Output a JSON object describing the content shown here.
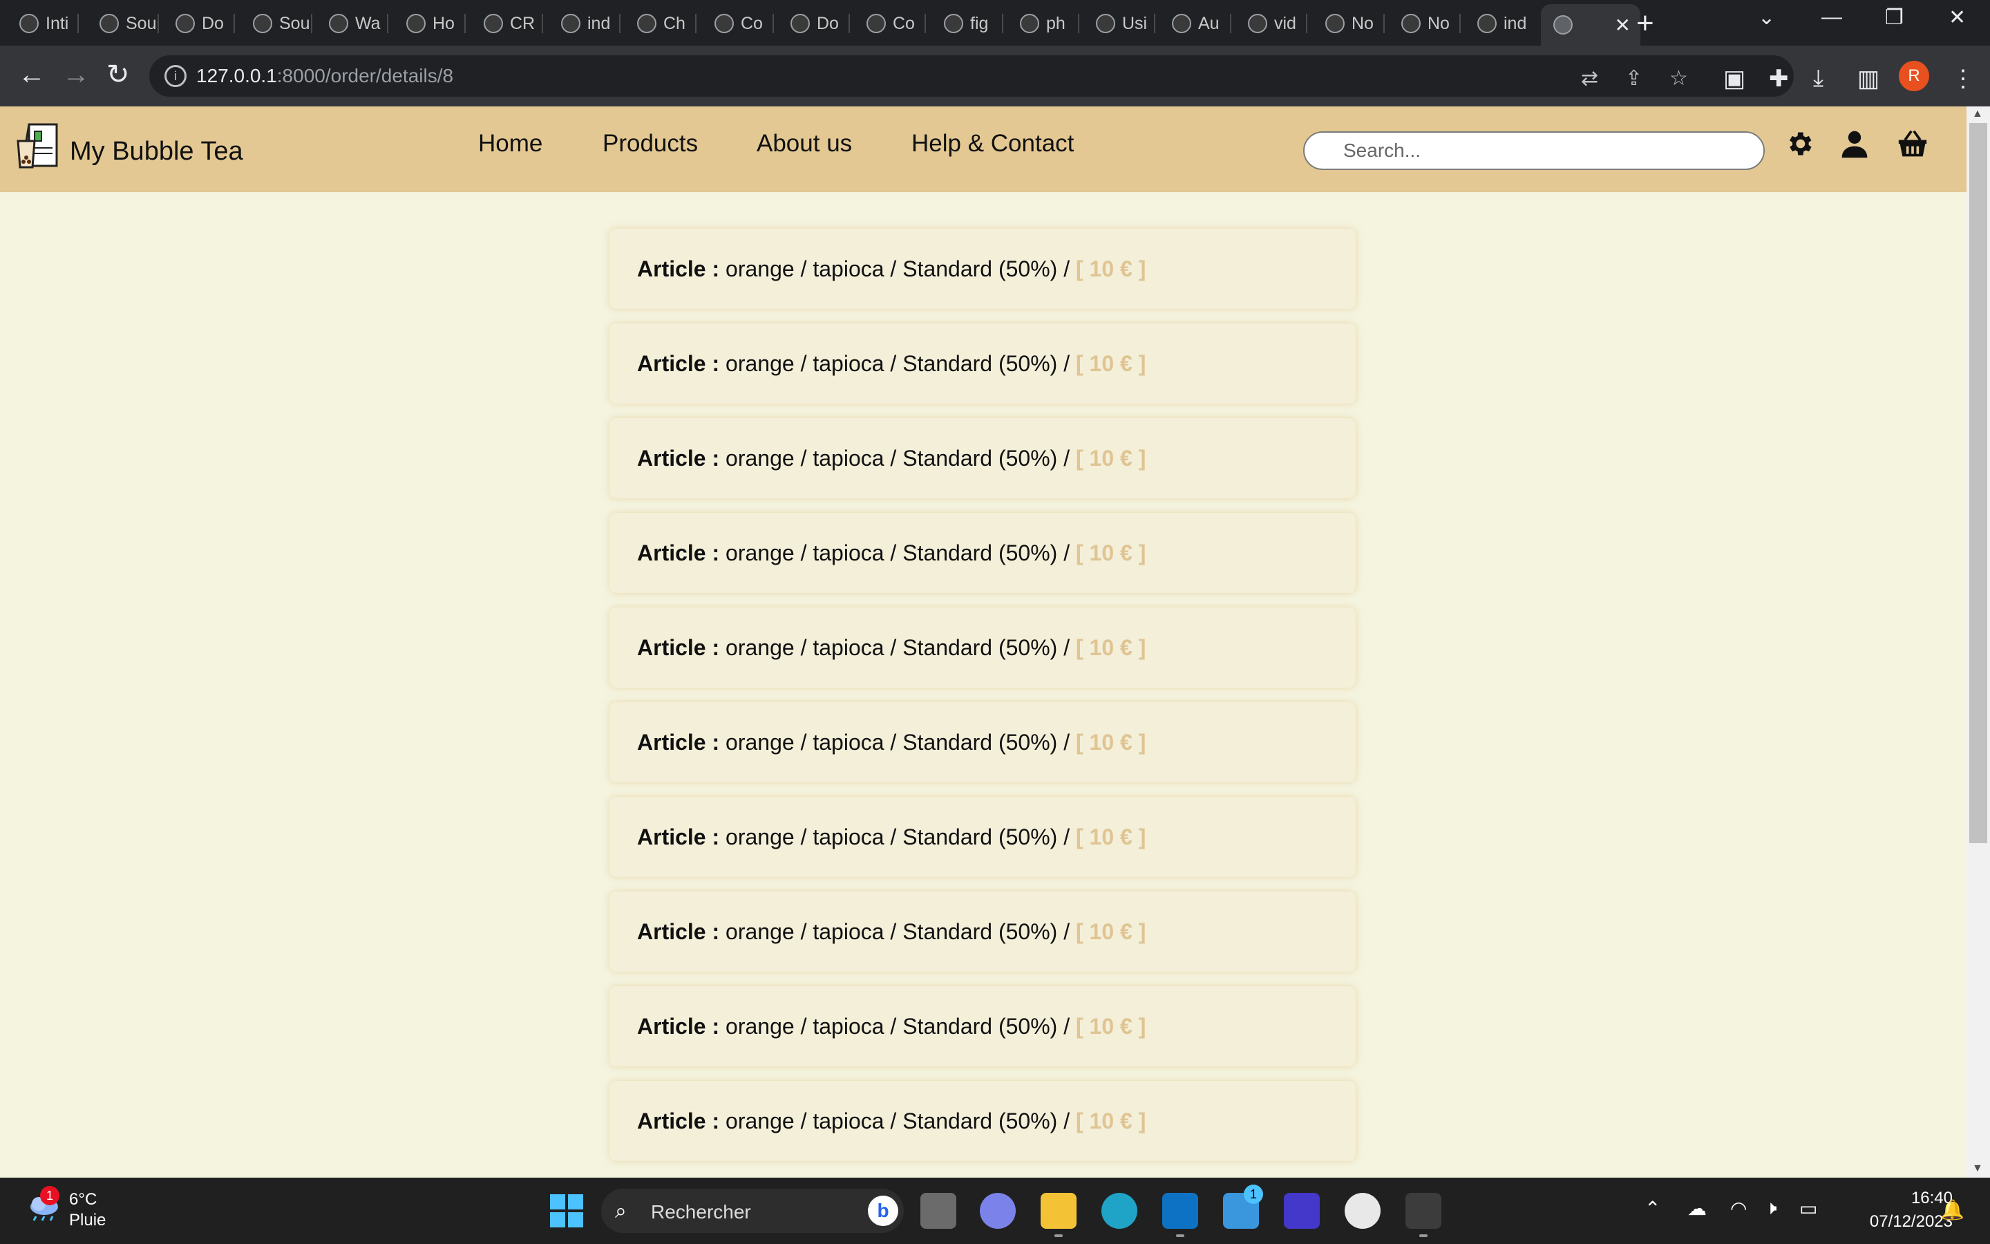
{
  "browser": {
    "tabs": [
      {
        "label": "Inti"
      },
      {
        "label": "Sou"
      },
      {
        "label": "Do"
      },
      {
        "label": "Sou"
      },
      {
        "label": "Wa"
      },
      {
        "label": "Ho"
      },
      {
        "label": "CR"
      },
      {
        "label": "ind"
      },
      {
        "label": "Ch"
      },
      {
        "label": "Co"
      },
      {
        "label": "Do"
      },
      {
        "label": "Co"
      },
      {
        "label": "fig"
      },
      {
        "label": "ph"
      },
      {
        "label": "Usi"
      },
      {
        "label": "Au"
      },
      {
        "label": "vid"
      },
      {
        "label": "No"
      },
      {
        "label": "No"
      },
      {
        "label": "ind"
      }
    ],
    "url_host": "127.0.0.1",
    "url_path": ":8000/order/details/8",
    "profile_initial": "R"
  },
  "site": {
    "brand": "My Bubble Tea",
    "nav": [
      {
        "label": "Home"
      },
      {
        "label": "Products"
      },
      {
        "label": "About us"
      },
      {
        "label": "Help & Contact"
      }
    ],
    "search_placeholder": "Search..."
  },
  "order": {
    "items": [
      {
        "label": "Article :",
        "desc": "orange / tapioca / Standard (50%) /",
        "price": "[ 10 € ]"
      },
      {
        "label": "Article :",
        "desc": "orange / tapioca / Standard (50%) /",
        "price": "[ 10 € ]"
      },
      {
        "label": "Article :",
        "desc": "orange / tapioca / Standard (50%) /",
        "price": "[ 10 € ]"
      },
      {
        "label": "Article :",
        "desc": "orange / tapioca / Standard (50%) /",
        "price": "[ 10 € ]"
      },
      {
        "label": "Article :",
        "desc": "orange / tapioca / Standard (50%) /",
        "price": "[ 10 € ]"
      },
      {
        "label": "Article :",
        "desc": "orange / tapioca / Standard (50%) /",
        "price": "[ 10 € ]"
      },
      {
        "label": "Article :",
        "desc": "orange / tapioca / Standard (50%) /",
        "price": "[ 10 € ]"
      },
      {
        "label": "Article :",
        "desc": "orange / tapioca / Standard (50%) /",
        "price": "[ 10 € ]"
      },
      {
        "label": "Article :",
        "desc": "orange / tapioca / Standard (50%) /",
        "price": "[ 10 € ]"
      },
      {
        "label": "Article :",
        "desc": "orange / tapioca / Standard (50%) /",
        "price": "[ 10 € ]"
      }
    ]
  },
  "taskbar": {
    "weather_badge": "1",
    "temperature": "6°C",
    "weather": "Pluie",
    "search_placeholder": "Rechercher",
    "store_badge": "1",
    "time": "16:40",
    "date": "07/12/2023"
  },
  "colors": {
    "header_bg": "#e3c893",
    "page_bg": "#f4f4df",
    "card_bg": "#f3efd9",
    "price": "#e0c493"
  },
  "icons": {
    "header": [
      "settings-gear-icon",
      "user-account-icon",
      "shopping-basket-icon"
    ]
  }
}
